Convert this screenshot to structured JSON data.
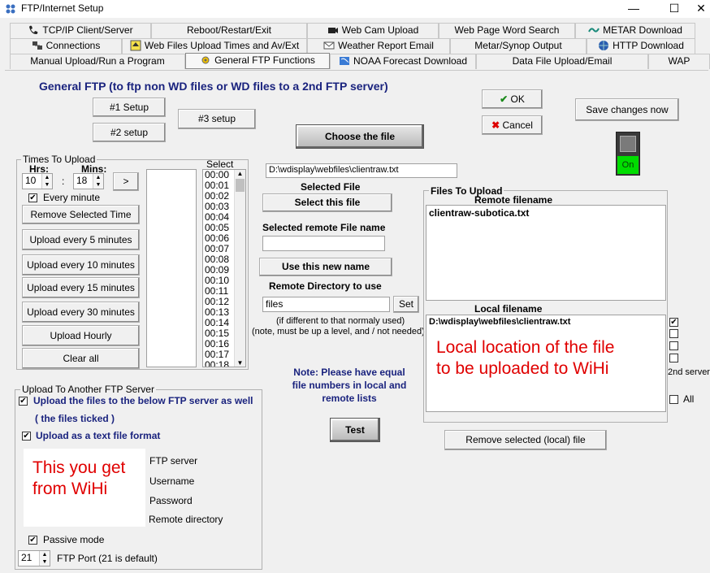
{
  "window": {
    "title": "FTP/Internet Setup",
    "minimize": "—",
    "maximize": "☐",
    "close": "✕"
  },
  "tabs": {
    "row1": [
      "TCP/IP Client/Server",
      "Reboot/Restart/Exit",
      "Web Cam Upload",
      "Web Page Word Search",
      "METAR Download"
    ],
    "row2": [
      "Connections",
      "Web Files Upload Times and  Av/Ext",
      "Weather Report Email",
      "Metar/Synop Output",
      "HTTP Download"
    ],
    "row3": [
      "Manual Upload/Run a Program",
      "General FTP Functions",
      "NOAA Forecast Download",
      "Data File Upload/Email",
      "WAP"
    ],
    "active": "General FTP Functions"
  },
  "header": {
    "title": "General FTP (to ftp non WD files or WD files to a 2nd FTP server)"
  },
  "setup": {
    "s1": "#1 Setup",
    "s2": "#2 setup",
    "s3": "#3 setup"
  },
  "actions": {
    "ok": "OK",
    "cancel": "Cancel",
    "save": "Save changes now",
    "toggle": "On"
  },
  "times": {
    "group_label": "Times To Upload",
    "hrs_label": "Hrs:",
    "mins_label": "Mins:",
    "hrs": "10",
    "mins": "18",
    "colon": ":",
    "arrow": ">",
    "every_minute": "Every minute",
    "remove": "Remove Selected Time",
    "every5": "Upload every 5 minutes",
    "every10": "Upload every 10 minutes",
    "every15": "Upload every 15 minutes",
    "every30": "Upload every 30 minutes",
    "hourly": "Upload Hourly",
    "clear": "Clear all",
    "select_label": "Select",
    "list": [
      "00:00",
      "00:01",
      "00:02",
      "00:03",
      "00:04",
      "00:05",
      "00:06",
      "00:07",
      "00:08",
      "00:09",
      "00:10",
      "00:11",
      "00:12",
      "00:13",
      "00:14",
      "00:15",
      "00:16",
      "00:17",
      "00:18"
    ]
  },
  "file": {
    "choose": "Choose the file",
    "path": "D:\\wdisplay\\webfiles\\clientraw.txt",
    "selected_label": "Selected File",
    "select_btn": "Select this file",
    "remote_name_label": "Selected remote File name",
    "remote_name": "",
    "use_name": "Use this new name",
    "remote_dir_label": "Remote Directory to use",
    "remote_dir": "files",
    "set": "Set",
    "note1": "(if different to that normaly used)",
    "note2": "(note, must be up a level, and / not needed)"
  },
  "files_to_upload": {
    "group_label": "Files To Upload",
    "remote_header": "Remote filename",
    "remote_item": "clientraw-subotica.txt",
    "local_header": "Local filename",
    "local_item": "D:\\wdisplay\\webfiles\\clientraw.txt",
    "annotation": "Local location of the file\nto be uploaded to WiHi",
    "second_server": "2nd server",
    "all": "All",
    "remove": "Remove selected (local) file"
  },
  "note": {
    "text": "Note: Please have equal\nfile numbers in local and\nremote lists",
    "test": "Test"
  },
  "another": {
    "group_label": "Upload To Another FTP Server",
    "upload_below": "Upload the files to the below FTP server as well",
    "files_ticked": "( the files ticked )",
    "text_format": "Upload as a text file format",
    "annotation": "This you get\nfrom WiHi",
    "ftp_server": "FTP server",
    "username": "Username",
    "password": "Password",
    "remote_directory": "Remote directory",
    "passive": "Passive mode",
    "port": "21",
    "port_label": "FTP Port (21 is default)"
  },
  "colors": {
    "accent_blue": "#1a237e",
    "annotation_red": "#e00000",
    "toggle_green": "#00dd00"
  }
}
